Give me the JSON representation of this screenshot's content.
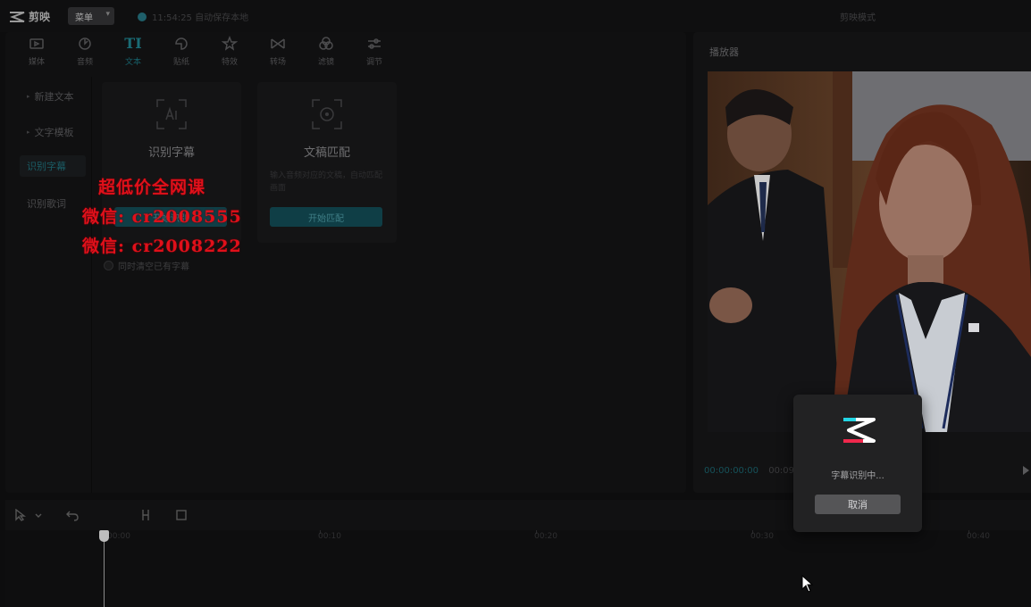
{
  "app": {
    "name": "剪映",
    "menu_label": "菜单",
    "autosave_text": "11:54:25 自动保存本地",
    "top_right_title": "剪映模式"
  },
  "tabs": [
    {
      "label": "媒体",
      "icon": "media-icon"
    },
    {
      "label": "音频",
      "icon": "audio-icon"
    },
    {
      "label": "文本",
      "icon": "text-icon",
      "active": true
    },
    {
      "label": "贴纸",
      "icon": "sticker-icon"
    },
    {
      "label": "特效",
      "icon": "effects-icon"
    },
    {
      "label": "转场",
      "icon": "transition-icon"
    },
    {
      "label": "滤镜",
      "icon": "filter-icon"
    },
    {
      "label": "调节",
      "icon": "adjust-icon"
    }
  ],
  "sidenav": {
    "items": [
      {
        "label": "新建文本",
        "caret": "▸"
      },
      {
        "label": "文字模板",
        "caret": "▸"
      },
      {
        "label": "识别字幕",
        "caret": "",
        "active": true
      },
      {
        "label": "识别歌词",
        "caret": ""
      }
    ]
  },
  "cards": {
    "recognize": {
      "title": "识别字幕",
      "button": "开始识别"
    },
    "match": {
      "title": "文稿匹配",
      "description": "输入音频对应的文稿，自动匹配画面",
      "button": "开始匹配"
    }
  },
  "clear_checkbox_label": "同时清空已有字幕",
  "watermark": {
    "line1": "超低价全网课",
    "line2": "微信: cr2008555",
    "line3": "微信: cr2008222"
  },
  "player": {
    "title": "播放器",
    "current_time": "00:00:00:00",
    "total_time": "00:09:24"
  },
  "timeline": {
    "ticks": [
      "00:00",
      "00:10",
      "00:20",
      "00:30",
      "00:40"
    ]
  },
  "dialog": {
    "status": "字幕识别中...",
    "cancel_label": "取消"
  },
  "colors": {
    "accent": "#1a6b75",
    "watermark": "#e0101a"
  }
}
